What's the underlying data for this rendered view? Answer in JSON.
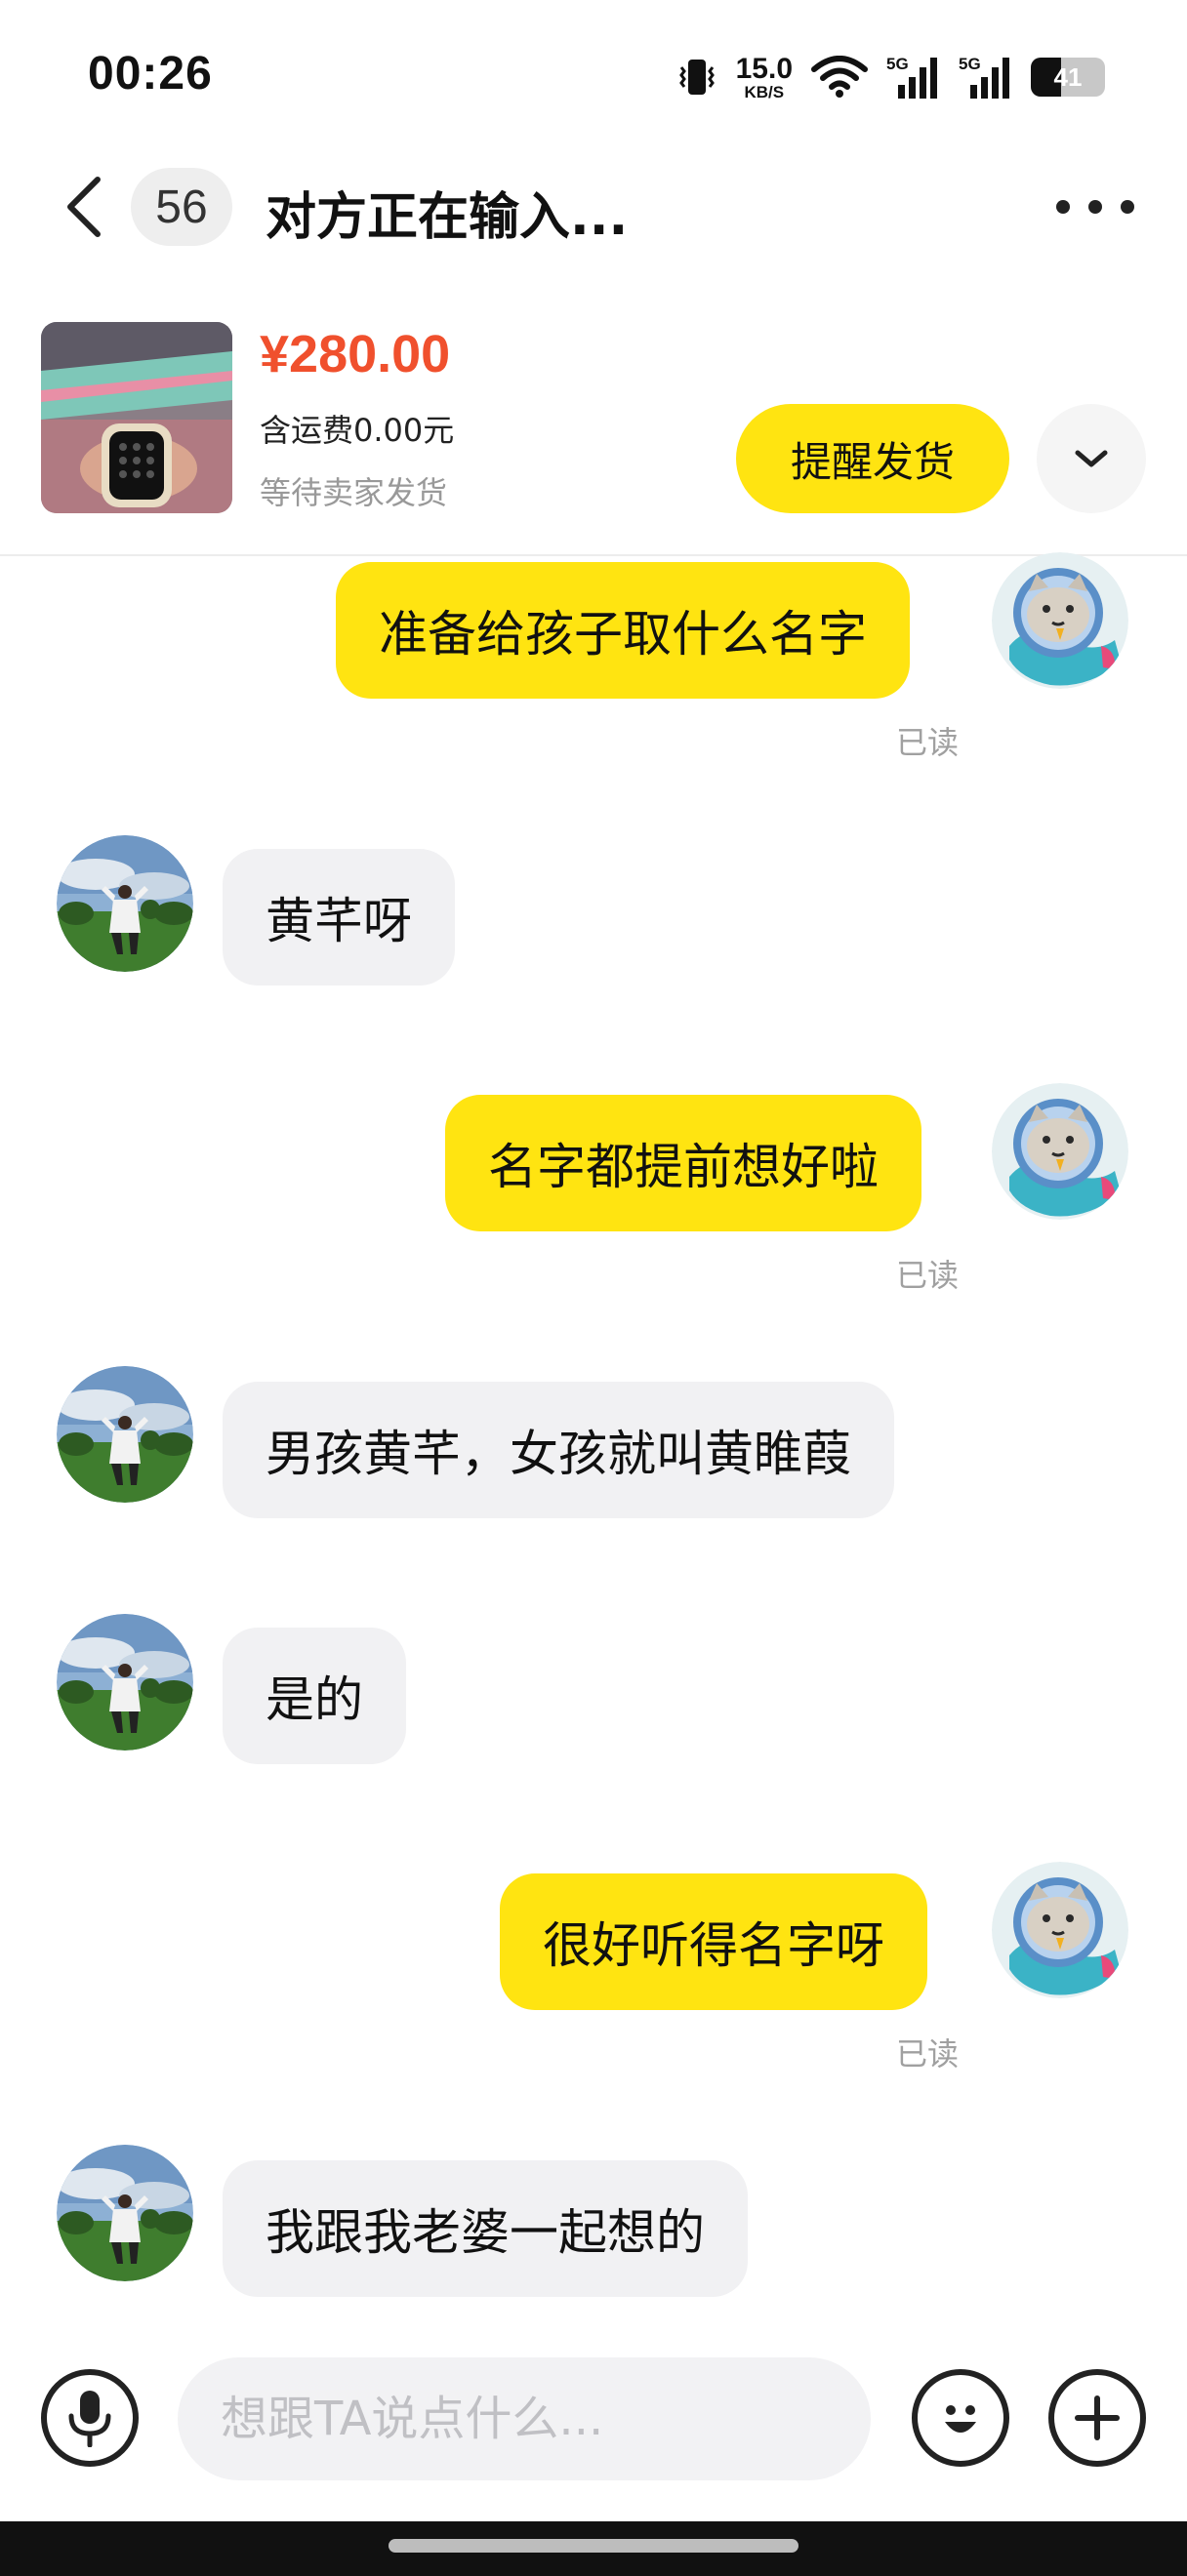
{
  "status_bar": {
    "time": "00:26",
    "net_speed_value": "15.0",
    "net_speed_unit": "KB/S",
    "signal1_label": "5G",
    "signal2_label": "5G",
    "battery_level": "41",
    "battery_fraction": 0.41,
    "icons": [
      "vibrate-icon",
      "wifi-icon",
      "signal-5g-icon",
      "signal-5g-icon",
      "battery-icon"
    ]
  },
  "header": {
    "back_icon": "chevron-left-icon",
    "unread_count": "56",
    "title": "对方正在输入...",
    "more_icon": "more-dots-icon"
  },
  "order": {
    "price": "¥280.00",
    "shipping": "含运费0.00元",
    "status": "等待卖家发货",
    "remind_label": "提醒发货",
    "expand_icon": "chevron-down-icon"
  },
  "messages": [
    {
      "side": "out",
      "text": "准备给孩子取什么名字",
      "read": "已读"
    },
    {
      "side": "in",
      "text": "黄芊呀"
    },
    {
      "side": "out",
      "text": "名字都提前想好啦",
      "read": "已读"
    },
    {
      "side": "in",
      "text": "男孩黄芊，女孩就叫黄睢葭"
    },
    {
      "side": "in",
      "text": "是的"
    },
    {
      "side": "out",
      "text": "很好听得名字呀",
      "read": "已读"
    },
    {
      "side": "in",
      "text": "我跟我老婆一起想的"
    }
  ],
  "input_bar": {
    "voice_icon": "microphone-icon",
    "placeholder": "想跟TA说点什么...",
    "value": "",
    "emoji_icon": "emoji-icon",
    "plus_icon": "plus-icon"
  },
  "colors": {
    "accent_yellow": "#ffe411",
    "price_red": "#f0502d",
    "incoming_bubble": "#f1f1f3",
    "muted_text": "#a0a0a0"
  }
}
